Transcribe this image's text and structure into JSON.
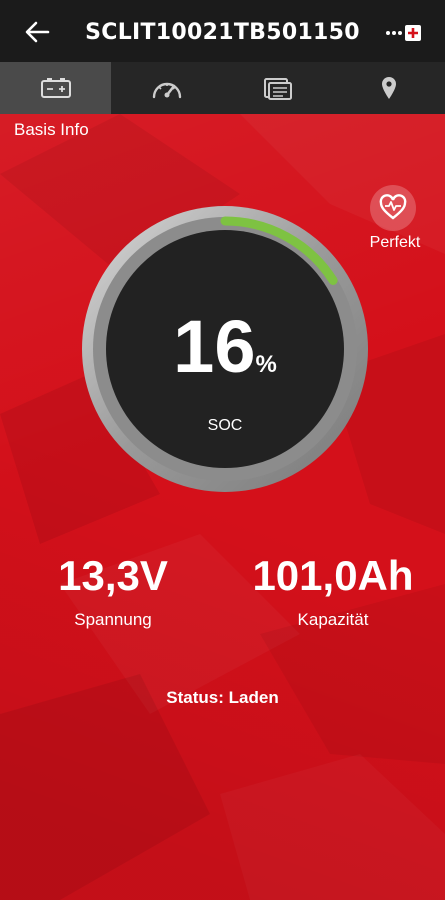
{
  "header": {
    "title": "SCLIT10021TB501150",
    "back_icon": "arrow-left-icon",
    "menu_icon": "more-with-plus-icon"
  },
  "tabs": [
    {
      "icon": "battery-icon",
      "active": true
    },
    {
      "icon": "speedometer-icon",
      "active": false
    },
    {
      "icon": "folder-list-icon",
      "active": false
    },
    {
      "icon": "location-pin-icon",
      "active": false
    }
  ],
  "main": {
    "section_title": "Basis Info",
    "health": {
      "label": "Perfekt",
      "icon": "heart-pulse-icon"
    },
    "soc": {
      "value": "16",
      "unit": "%",
      "label": "SOC",
      "level": 0.16
    },
    "voltage": {
      "value": "13,3V",
      "label": "Spannung"
    },
    "capacity": {
      "value": "101,0Ah",
      "label": "Kapazität"
    },
    "status": "Status: Laden"
  },
  "colors": {
    "background_red": "#d4101a",
    "topbar": "#1b1b1b",
    "tabbar": "#262626",
    "tab_active": "#4a4a4a",
    "gauge_fill": "#7ec242",
    "gauge_inner": "#222222"
  }
}
